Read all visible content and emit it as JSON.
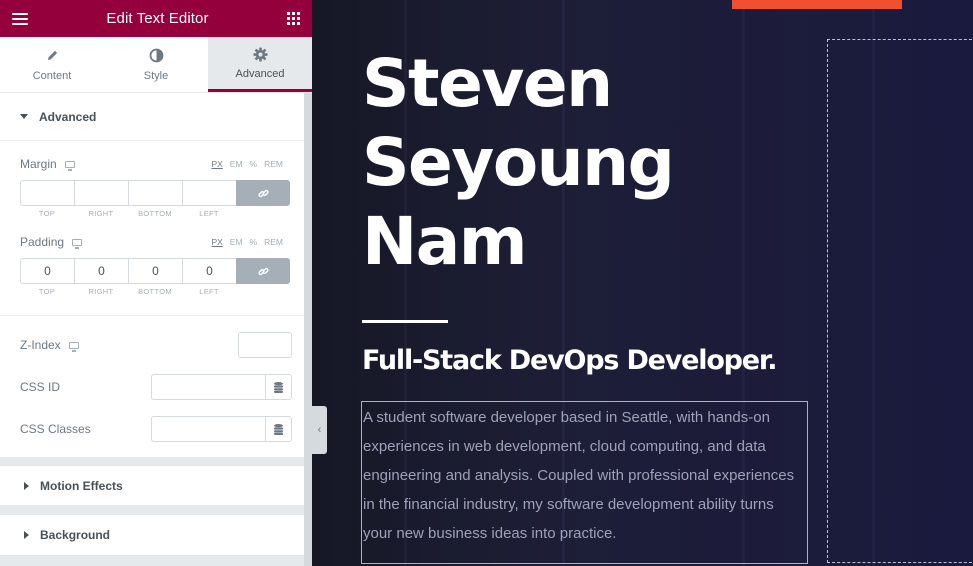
{
  "panel": {
    "title": "Edit Text Editor",
    "tabs": [
      {
        "label": "Content",
        "icon": "pencil-icon"
      },
      {
        "label": "Style",
        "icon": "half-circle-icon"
      },
      {
        "label": "Advanced",
        "icon": "gear-icon",
        "active": true
      }
    ],
    "advanced": {
      "heading": "Advanced",
      "margin": {
        "label": "Margin",
        "units": [
          "PX",
          "EM",
          "%",
          "REM"
        ],
        "selected_unit": "PX",
        "values": {
          "top": "",
          "right": "",
          "bottom": "",
          "left": ""
        },
        "side_labels": [
          "TOP",
          "RIGHT",
          "BOTTOM",
          "LEFT"
        ]
      },
      "padding": {
        "label": "Padding",
        "units": [
          "PX",
          "EM",
          "%",
          "REM"
        ],
        "selected_unit": "PX",
        "values": {
          "top": "0",
          "right": "0",
          "bottom": "0",
          "left": "0"
        },
        "side_labels": [
          "TOP",
          "RIGHT",
          "BOTTOM",
          "LEFT"
        ]
      },
      "z_index": {
        "label": "Z-Index",
        "value": ""
      },
      "css_id": {
        "label": "CSS ID",
        "value": ""
      },
      "css_classes": {
        "label": "CSS Classes",
        "value": ""
      }
    },
    "motion_effects": {
      "heading": "Motion Effects"
    },
    "background": {
      "heading": "Background"
    }
  },
  "preview": {
    "name": "Steven Seyoung Nam",
    "subtitle": "Full-Stack DevOps Developer.",
    "description": "A student software developer based in Seattle, with hands-on experiences in web development, cloud computing, and data engineering and analysis. Coupled with professional experiences in the financial industry, my software development ability turns your new business ideas into practice."
  },
  "colors": {
    "accent": "#93003c",
    "orange": "#f0502e",
    "selection_border": "#71c7e7"
  }
}
